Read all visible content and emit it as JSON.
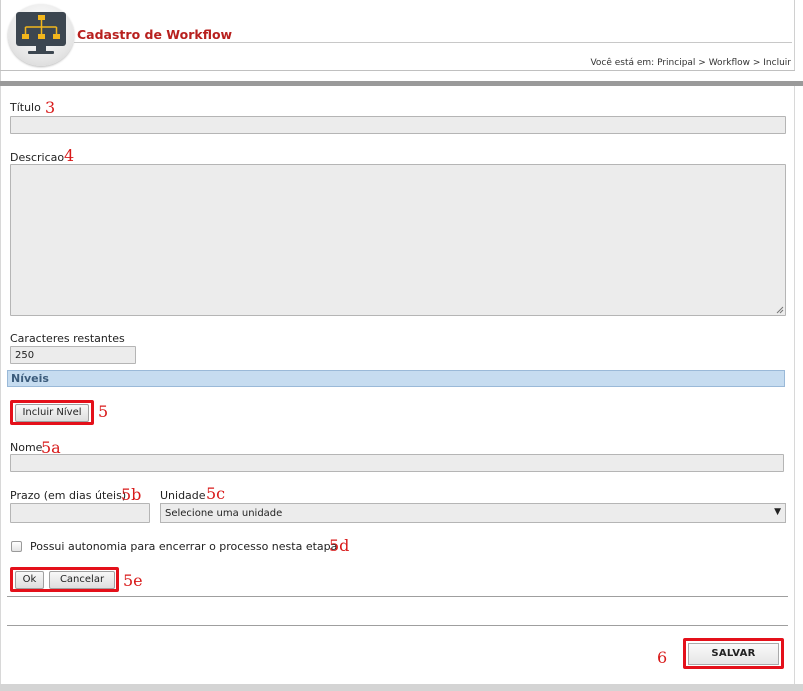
{
  "header": {
    "title": "Cadastro de Workflow",
    "breadcrumb": "Você está em: Principal > Workflow > Incluir"
  },
  "form": {
    "titulo_label": "Título",
    "titulo_value": "",
    "descricao_label": "Descricao",
    "descricao_value": "",
    "caracteres_label": "Caracteres restantes",
    "caracteres_value": "250",
    "niveis_section": "Níveis",
    "incluir_nivel_button": "Incluir Nível",
    "nome_label": "Nome",
    "nome_value": "",
    "prazo_label": "Prazo (em dias úteis)",
    "prazo_value": "",
    "unidade_label": "Unidade",
    "unidade_selected": "Selecione uma unidade",
    "autonomia_label": "Possui autonomia para encerrar o processo nesta etapa",
    "autonomia_checked": false,
    "ok_button": "Ok",
    "cancelar_button": "Cancelar",
    "salvar_button": "SALVAR"
  },
  "annotations": {
    "titulo": "3",
    "descricao": "4",
    "incluir": "5",
    "nome": "5a",
    "prazo": "5b",
    "unidade": "5c",
    "autonomia": "5d",
    "okcancel": "5e",
    "salvar": "6"
  },
  "colors": {
    "title_red": "#b8201e",
    "annotation_red": "#d81a1a",
    "highlight_box": "#e4101a",
    "section_bar": "#c6dcf0",
    "field_bg": "#ececec"
  },
  "icons": {
    "logo": "workflow-monitor-icon",
    "select_arrow": "triangle-down-icon"
  }
}
